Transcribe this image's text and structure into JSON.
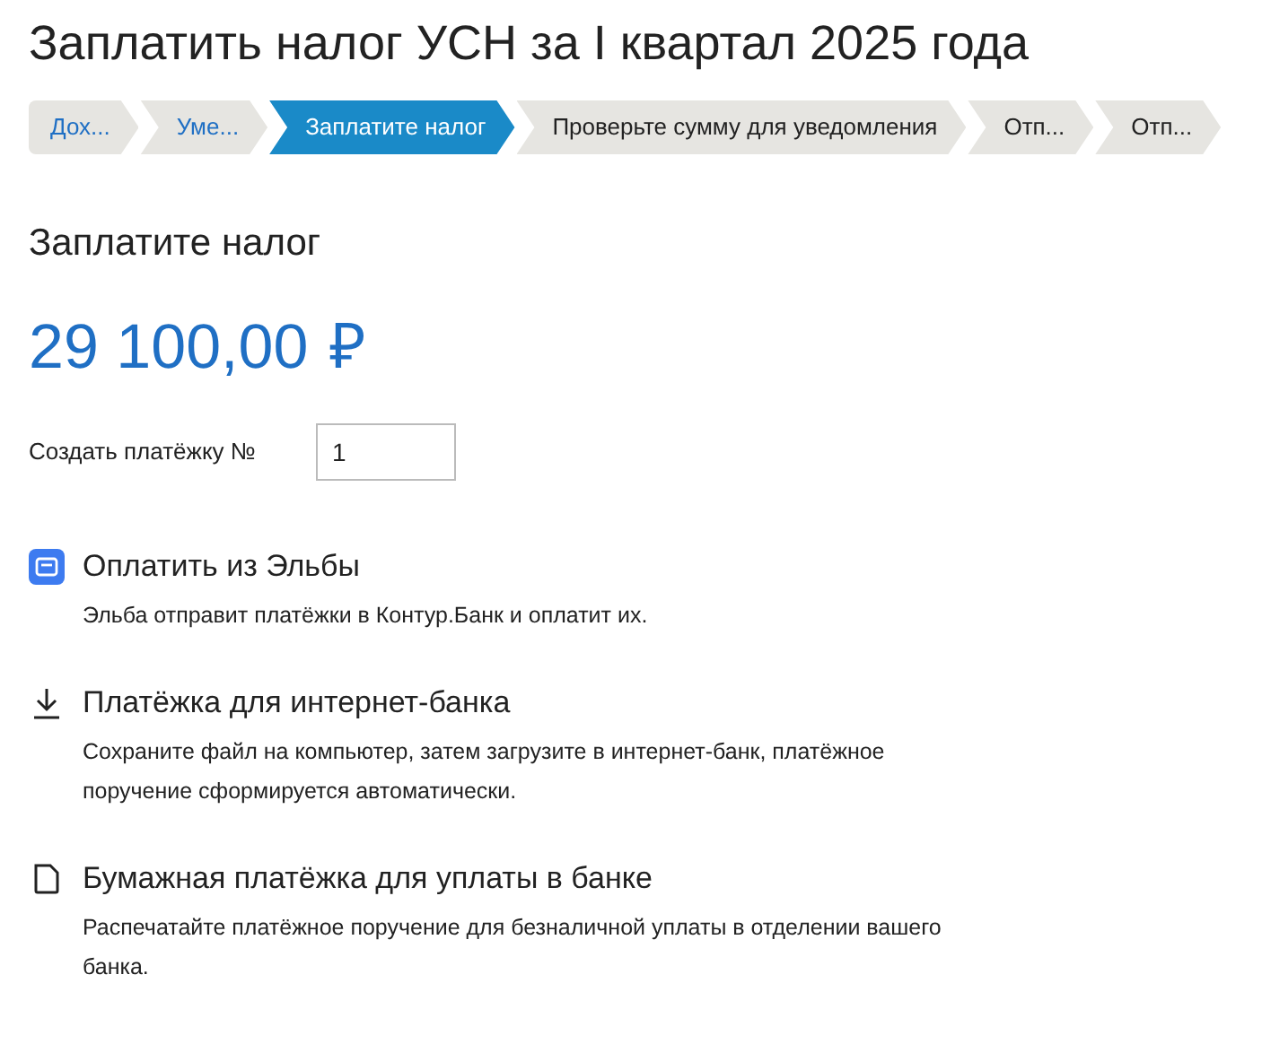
{
  "title": "Заплатить налог УСН за I квартал 2025 года",
  "steps": [
    {
      "label": "Дох...",
      "done": true,
      "selected": false
    },
    {
      "label": "Уме...",
      "done": true,
      "selected": false
    },
    {
      "label": "Заплатите налог",
      "done": false,
      "selected": true
    },
    {
      "label": "Проверьте сумму для уведомления",
      "done": false,
      "selected": false
    },
    {
      "label": "Отп...",
      "done": false,
      "selected": false
    },
    {
      "label": "Отп...",
      "done": false,
      "selected": false
    }
  ],
  "heading": "Заплатите налог",
  "amount": "29 100,00",
  "currency": "₽",
  "payment_number": {
    "label": "Создать платёжку №",
    "value": "1"
  },
  "options": [
    {
      "kind": "elba",
      "title": "Оплатить из Эльбы",
      "description": "Эльба отправит платёжки в Контур.Банк и оплатит их."
    },
    {
      "kind": "download",
      "title": "Платёжка для интернет-банка",
      "description": "Сохраните файл на компьютер, затем загрузите в интернет-банк, платёжное поручение сформируется автоматически."
    },
    {
      "kind": "document",
      "title": "Бумажная платёжка для уплаты в банке",
      "description": "Распечатайте платёжное поручение для безналичной уплаты в отделении вашего банка."
    }
  ]
}
